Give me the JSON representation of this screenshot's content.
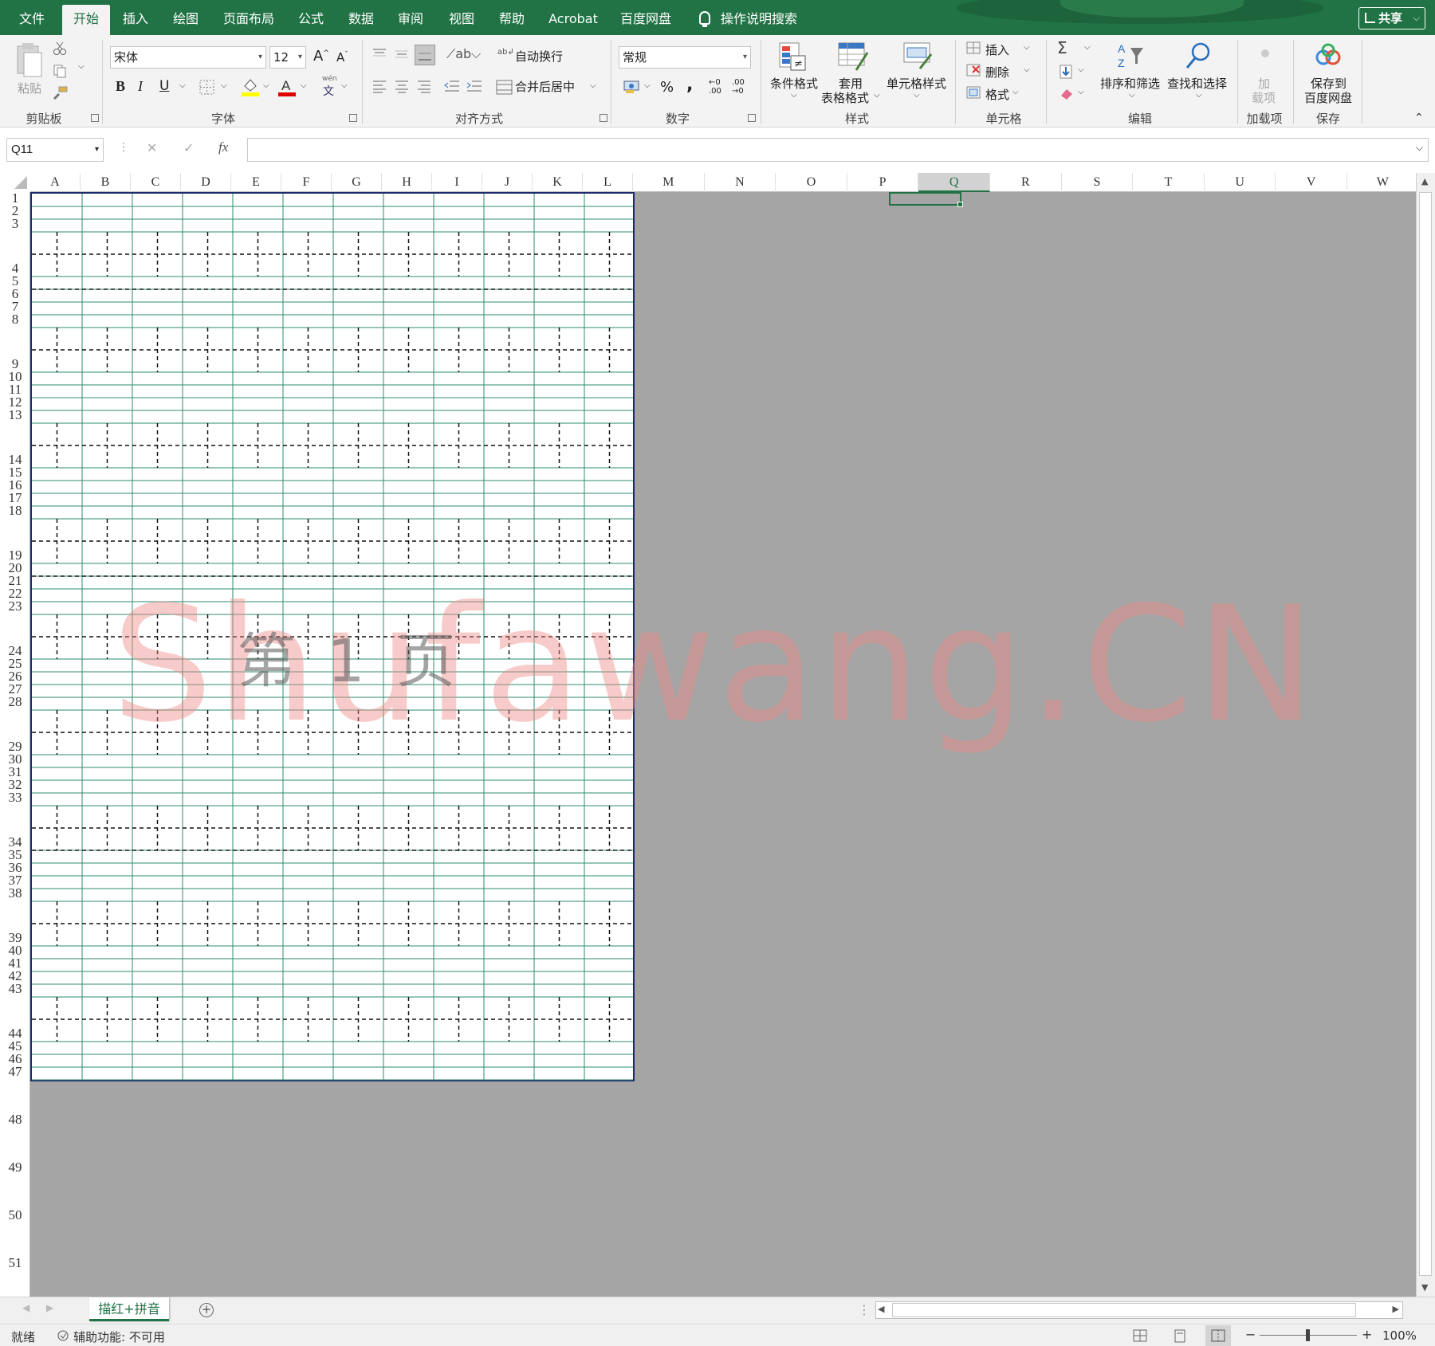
{
  "tabs": [
    {
      "label": "文件"
    },
    {
      "label": "开始"
    },
    {
      "label": "插入"
    },
    {
      "label": "绘图"
    },
    {
      "label": "页面布局"
    },
    {
      "label": "公式"
    },
    {
      "label": "数据"
    },
    {
      "label": "审阅"
    },
    {
      "label": "视图"
    },
    {
      "label": "帮助"
    },
    {
      "label": "Acrobat"
    },
    {
      "label": "百度网盘"
    }
  ],
  "active_tab": "开始",
  "tell_me": "操作说明搜索",
  "share_label": "共享",
  "ribbon": {
    "clipboard": {
      "paste": "粘贴",
      "label": "剪贴板"
    },
    "font": {
      "name": "宋体",
      "size": "12",
      "bold": "B",
      "italic": "I",
      "underline": "U",
      "grow": "A",
      "shrink": "A",
      "phonetic_top": "wén",
      "phonetic": "文",
      "label": "字体"
    },
    "alignment": {
      "wrap": "自动换行",
      "merge": "合并后居中",
      "label": "对齐方式"
    },
    "number": {
      "format": "常规",
      "percent": "%",
      "comma": ",",
      "label": "数字"
    },
    "styles": {
      "conditional": "条件格式",
      "table_line1": "套用",
      "table_line2": "表格格式",
      "cell_styles": "单元格样式",
      "label": "样式"
    },
    "cells": {
      "insert": "插入",
      "delete": "删除",
      "format": "格式",
      "label": "单元格"
    },
    "editing": {
      "sort": "排序和筛选",
      "find": "查找和选择",
      "label": "编辑"
    },
    "addins": {
      "line1": "加",
      "line2": "载项",
      "label": "加载项"
    },
    "save": {
      "line1": "保存到",
      "line2": "百度网盘",
      "label": "保存"
    }
  },
  "formula": {
    "namebox": "Q11",
    "fx": "fx",
    "cancel": "✕",
    "enter": "✓",
    "content": ""
  },
  "columns": [
    "A",
    "B",
    "C",
    "D",
    "E",
    "F",
    "G",
    "H",
    "I",
    "J",
    "K",
    "L",
    "M",
    "N",
    "O",
    "P",
    "Q",
    "R",
    "S",
    "T",
    "U",
    "V",
    "W"
  ],
  "selected_column": "Q",
  "rows": [
    "1",
    "2",
    "3",
    "4",
    "5",
    "6",
    "7",
    "8",
    "9",
    "10",
    "11",
    "12",
    "13",
    "14",
    "15",
    "16",
    "17",
    "18",
    "19",
    "20",
    "21",
    "22",
    "23",
    "24",
    "25",
    "26",
    "27",
    "28",
    "29",
    "30",
    "31",
    "32",
    "33",
    "34",
    "35",
    "36",
    "37",
    "38",
    "39",
    "40",
    "41",
    "42",
    "43",
    "44",
    "45",
    "46",
    "47",
    "48",
    "49",
    "50",
    "51"
  ],
  "page_label": "第 1 页",
  "watermark": "Shufawang.CN",
  "sheet_tab": "描红+拼音",
  "add_sheet": "+",
  "status": {
    "ready": "就绪",
    "accessibility": "辅助功能: 不可用",
    "zoom": "100%"
  },
  "colors": {
    "accent": "#217346",
    "page_border": "#1c2a6b",
    "grid_line": "#2e8b70",
    "gray_area": "#a5a5a5"
  },
  "icons": [
    "cut-icon",
    "copy-icon",
    "format-painter-icon",
    "borders-icon",
    "fill-color-icon",
    "font-color-icon",
    "lightbulb-icon",
    "share-icon",
    "autosum-icon",
    "fill-icon",
    "clear-icon",
    "sort-filter-icon",
    "find-icon",
    "baidu-cloud-icon",
    "normal-view-icon",
    "page-layout-view-icon",
    "page-break-view-icon"
  ]
}
